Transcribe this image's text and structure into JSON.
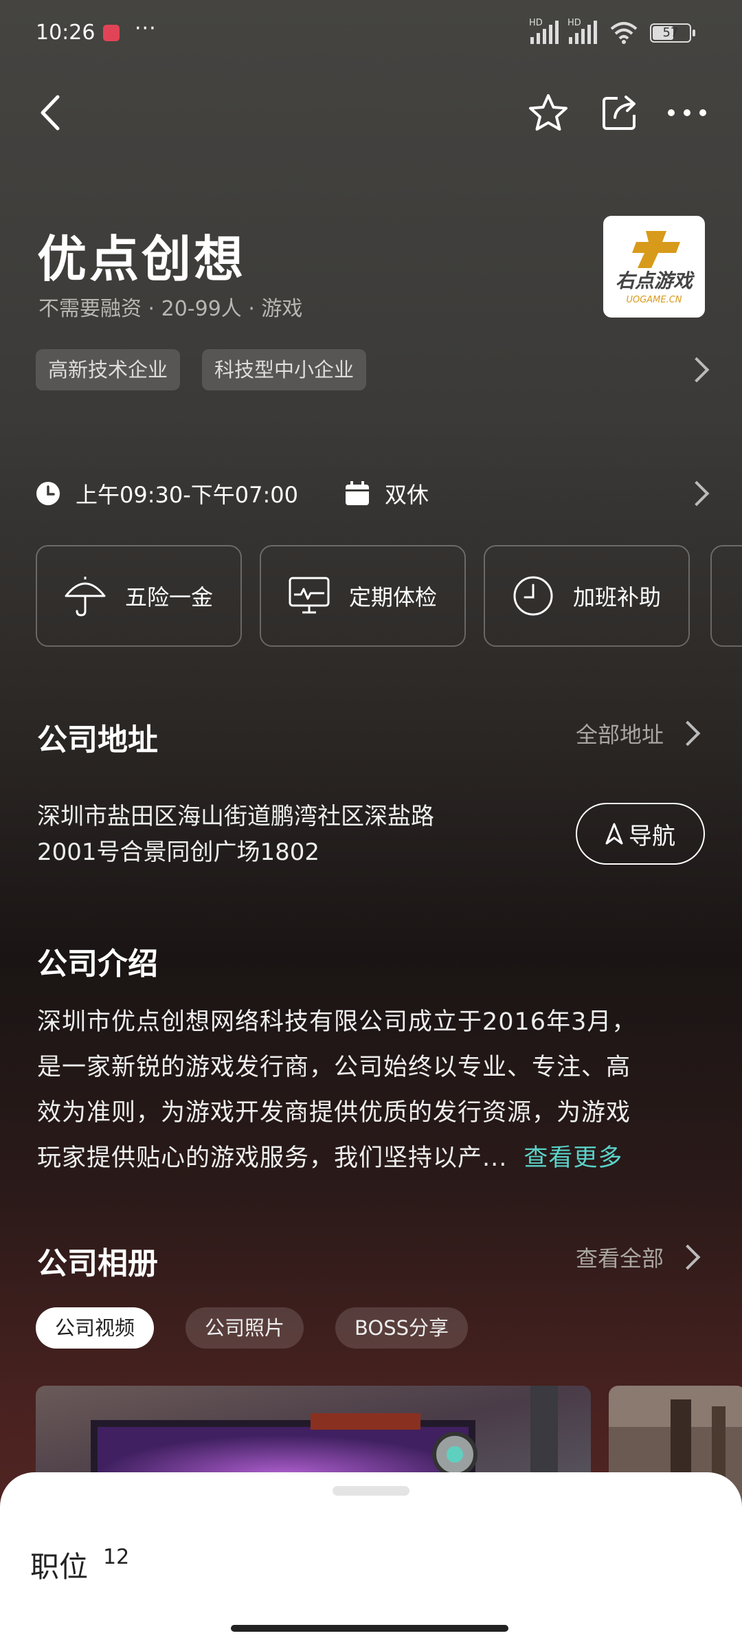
{
  "status_bar": {
    "time": "10:26",
    "more": "···",
    "battery": "57",
    "battery_level": 0.57,
    "network_1": "HD",
    "network_2": "HD"
  },
  "toolbar": {
    "back": "back-arrow-icon",
    "favorite": "star-icon",
    "share": "share-icon",
    "more": "more-icon"
  },
  "company": {
    "name": "优点创想",
    "subtitle": "不需要融资 · 20-99人 · 游戏",
    "logo_text": "右点游戏",
    "logo_sub": "UOGAME.CN",
    "tags": [
      "高新技术企业",
      "科技型中小企业"
    ]
  },
  "work": {
    "hours": "上午09:30-下午07:00",
    "rest": "双休"
  },
  "benefits": [
    "五险一金",
    "定期体检",
    "加班补助"
  ],
  "address_section": {
    "title": "公司地址",
    "link": "全部地址",
    "line1": "深圳市盐田区海山街道鹏湾社区深盐路",
    "line2": "2001号合景同创广场1802",
    "nav_button": "导航"
  },
  "intro_section": {
    "title": "公司介绍",
    "line1": "深圳市优点创想网络科技有限公司成立于2016年3月，",
    "line2": "是一家新锐的游戏发行商，公司始终以专业、专注、高",
    "line3": "效为准则，为游戏开发商提供优质的发行资源，为游戏",
    "line4": "玩家提供贴心的游戏服务，我们坚持以产...",
    "more": "查看更多"
  },
  "album_section": {
    "title": "公司相册",
    "link": "查看全部",
    "tabs": [
      "公司视频",
      "公司照片",
      "BOSS分享"
    ]
  },
  "jobs": {
    "label": "职位",
    "count": "12"
  },
  "colors": {
    "accent": "#5ad2c8",
    "brand_logo": "#d89a1a"
  }
}
